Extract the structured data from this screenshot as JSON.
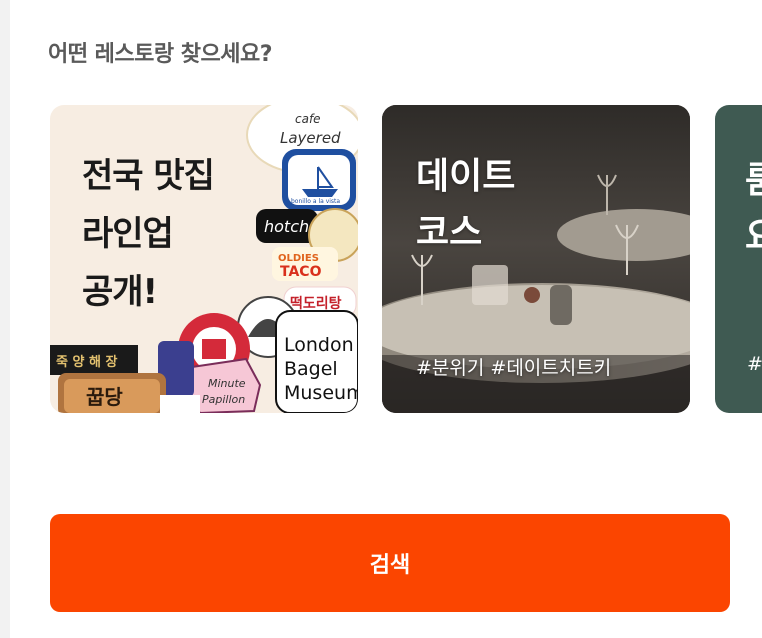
{
  "section": {
    "heading": "어떤 레스토랑 찾으세요?"
  },
  "cards": [
    {
      "title_lines": [
        "전국 맛집",
        "라인업",
        "공개!"
      ],
      "stickers": [
        "cafe",
        "Layered",
        "hotch",
        "OLDIES",
        "TACO",
        "떡도리탕",
        "London",
        "Bagel",
        "Museum",
        "Minute",
        "Papillon",
        "죽 양 해 장",
        "꿉당",
        "bonillo a la vista"
      ]
    },
    {
      "title_lines": [
        "데이트",
        "코스"
      ],
      "tags": "#분위기 #데이트치트키"
    },
    {
      "title_lines": [
        "룸",
        "요"
      ],
      "tags": "#"
    }
  ],
  "search_button": {
    "label": "검색"
  },
  "colors": {
    "accent": "#fb4500",
    "heading": "#5a5a5a",
    "page_bg": "#f2f2f2"
  }
}
